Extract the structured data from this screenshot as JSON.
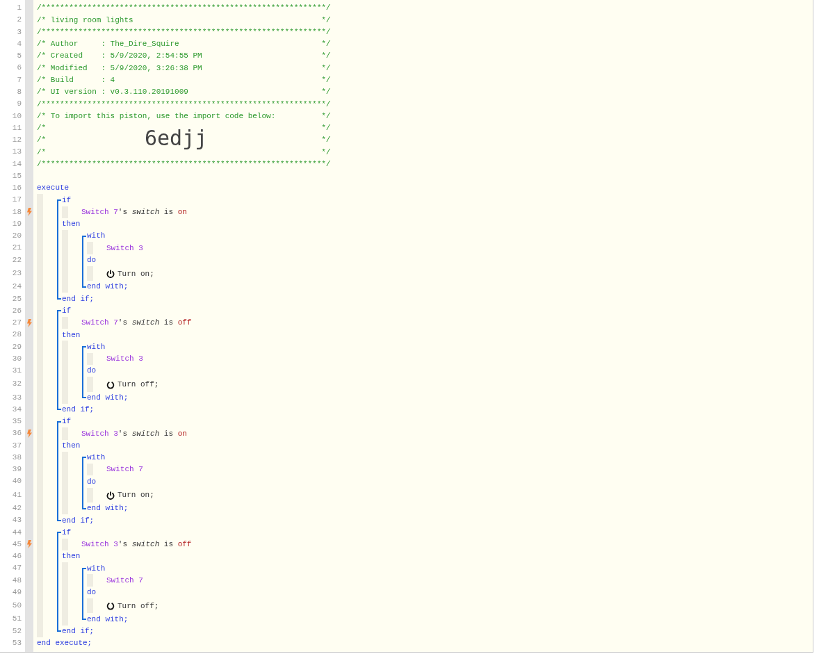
{
  "line_numbers": [
    "1",
    "2",
    "3",
    "4",
    "5",
    "6",
    "7",
    "8",
    "9",
    "10",
    "11",
    "12",
    "13",
    "14",
    "15",
    "16",
    "17",
    "18",
    "19",
    "20",
    "21",
    "22",
    "23",
    "24",
    "25",
    "26",
    "27",
    "28",
    "29",
    "30",
    "31",
    "32",
    "33",
    "34",
    "35",
    "36",
    "37",
    "38",
    "39",
    "40",
    "41",
    "42",
    "43",
    "44",
    "45",
    "46",
    "47",
    "48",
    "49",
    "50",
    "51",
    "52",
    "53"
  ],
  "header": [
    {
      "text": "/**************************************************************/"
    },
    {
      "text": "/* living room lights",
      "end": "*/"
    },
    {
      "text": "/**************************************************************/"
    },
    {
      "text": "/* Author     : The_Dire_Squire",
      "end": "*/"
    },
    {
      "text": "/* Created    : 5/9/2020, 2:54:55 PM",
      "end": "*/"
    },
    {
      "text": "/* Modified   : 5/9/2020, 3:26:38 PM",
      "end": "*/"
    },
    {
      "text": "/* Build      : 4",
      "end": "*/"
    },
    {
      "text": "/* UI version : v0.3.110.20191009",
      "end": "*/"
    },
    {
      "text": "/**************************************************************/"
    },
    {
      "text": "/* To import this piston, use the import code below:",
      "end": "*/"
    },
    {
      "text": "/*",
      "end": "*/"
    },
    {
      "text": "/*",
      "end": "*/",
      "import_code": "6edjj"
    },
    {
      "text": "/*",
      "end": "*/"
    },
    {
      "text": "/**************************************************************/"
    }
  ],
  "code": {
    "keyword": "execute",
    "end": "end execute;",
    "children": [
      {
        "kind": "if",
        "keyword": "if",
        "trigger": true,
        "condition": {
          "device": "Switch 7",
          "possessive": "'s",
          "attribute": "switch",
          "comparison": "is",
          "value": "on"
        },
        "then_keyword": "then",
        "end": "end if;",
        "then": [
          {
            "kind": "with",
            "keyword": "with",
            "device": "Switch 3",
            "do_keyword": "do",
            "end": "end with;",
            "actions": [
              {
                "kind": "power_on",
                "text": "Turn on;"
              }
            ]
          }
        ]
      },
      {
        "kind": "if",
        "keyword": "if",
        "trigger": true,
        "condition": {
          "device": "Switch 7",
          "possessive": "'s",
          "attribute": "switch",
          "comparison": "is",
          "value": "off"
        },
        "then_keyword": "then",
        "end": "end if;",
        "then": [
          {
            "kind": "with",
            "keyword": "with",
            "device": "Switch 3",
            "do_keyword": "do",
            "end": "end with;",
            "actions": [
              {
                "kind": "power_off",
                "text": "Turn off;"
              }
            ]
          }
        ]
      },
      {
        "kind": "if",
        "keyword": "if",
        "trigger": true,
        "condition": {
          "device": "Switch 3",
          "possessive": "'s",
          "attribute": "switch",
          "comparison": "is",
          "value": "on"
        },
        "then_keyword": "then",
        "end": "end if;",
        "then": [
          {
            "kind": "with",
            "keyword": "with",
            "device": "Switch 7",
            "do_keyword": "do",
            "end": "end with;",
            "actions": [
              {
                "kind": "power_on",
                "text": "Turn on;"
              }
            ]
          }
        ]
      },
      {
        "kind": "if",
        "keyword": "if",
        "trigger": true,
        "condition": {
          "device": "Switch 3",
          "possessive": "'s",
          "attribute": "switch",
          "comparison": "is",
          "value": "off"
        },
        "then_keyword": "then",
        "end": "end if;",
        "then": [
          {
            "kind": "with",
            "keyword": "with",
            "device": "Switch 7",
            "do_keyword": "do",
            "end": "end with;",
            "actions": [
              {
                "kind": "power_off",
                "text": "Turn off;"
              }
            ]
          }
        ]
      }
    ]
  }
}
